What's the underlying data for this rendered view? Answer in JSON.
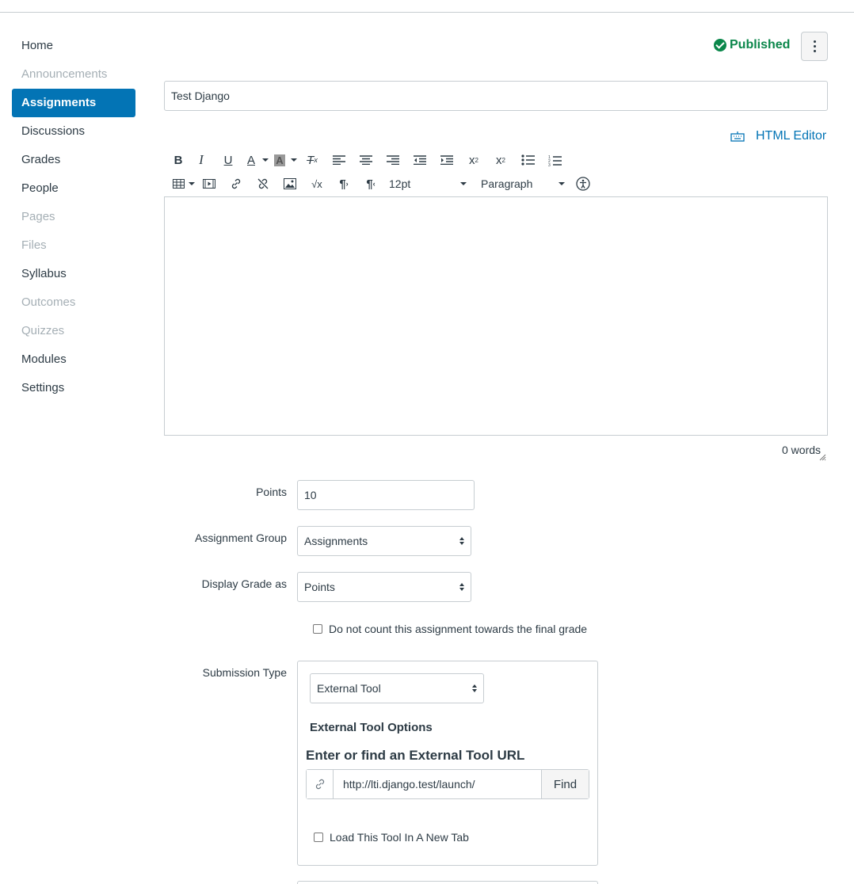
{
  "sidebar": {
    "items": [
      {
        "label": "Home",
        "state": "normal"
      },
      {
        "label": "Announcements",
        "state": "disabled"
      },
      {
        "label": "Assignments",
        "state": "active"
      },
      {
        "label": "Discussions",
        "state": "normal"
      },
      {
        "label": "Grades",
        "state": "normal"
      },
      {
        "label": "People",
        "state": "normal"
      },
      {
        "label": "Pages",
        "state": "disabled"
      },
      {
        "label": "Files",
        "state": "disabled"
      },
      {
        "label": "Syllabus",
        "state": "normal"
      },
      {
        "label": "Outcomes",
        "state": "disabled"
      },
      {
        "label": "Quizzes",
        "state": "disabled"
      },
      {
        "label": "Modules",
        "state": "normal"
      },
      {
        "label": "Settings",
        "state": "normal"
      }
    ]
  },
  "header": {
    "status": "Published",
    "status_color": "#0b874b",
    "menu_icon": "kebab-icon"
  },
  "assignment": {
    "title": "Test Django"
  },
  "editor": {
    "html_editor_label": "HTML Editor",
    "font_size": "12pt",
    "block_format": "Paragraph",
    "word_count": "0 words"
  },
  "form": {
    "points_label": "Points",
    "points_value": "10",
    "group_label": "Assignment Group",
    "group_value": "Assignments",
    "display_label": "Display Grade as",
    "display_value": "Points",
    "no_count_label": "Do not count this assignment towards the final grade",
    "submission_label": "Submission Type",
    "submission_value": "External Tool",
    "ext_tool_title": "External Tool Options",
    "url_title": "Enter or find an External Tool URL",
    "url_value": "http://lti.django.test/launch/",
    "find_label": "Find",
    "new_tab_label": "Load This Tool In A New Tab"
  },
  "colors": {
    "accent": "#0374b5",
    "text": "#2d3b45",
    "muted": "#a5afb5"
  }
}
